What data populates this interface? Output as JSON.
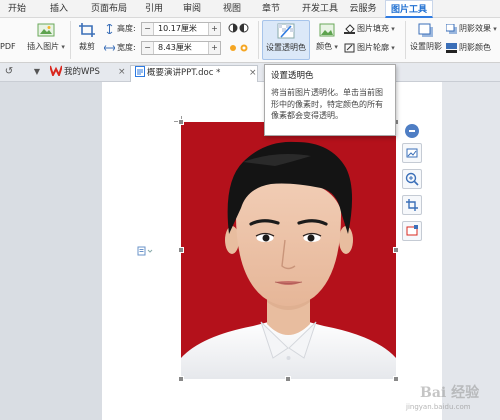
{
  "menu": {
    "tabs": [
      "开始",
      "插入",
      "页面布局",
      "引用",
      "审阅",
      "视图",
      "章节",
      "开发工具",
      "云服务",
      "图片工具"
    ],
    "active_tab": "图片工具"
  },
  "ribbon": {
    "pdf_label": "PDF",
    "insert_picture": "插入图片",
    "crop": "裁剪",
    "height_label": "高度:",
    "height_value": "10.17厘米",
    "width_label": "宽度:",
    "width_value": "8.43厘米",
    "set_transparent": "设置透明色",
    "color": "颜色",
    "picture_fill": "图片填充",
    "picture_outline": "图片轮廓",
    "set_shadow": "设置阴影",
    "shadow_effect": "阴影效果",
    "shadow_color": "阴影颜色",
    "minus": "−",
    "plus": "+"
  },
  "doc_tabs": {
    "tabs": [
      {
        "label": "我的WPS",
        "active": false
      },
      {
        "label": "概要演讲PPT.doc *",
        "active": true
      }
    ],
    "close_glyph": "×"
  },
  "tooltip": {
    "title": "设置透明色",
    "description": "将当前图片透明化。单击当前图形中的像素时，特定颜色的所有像素都会变得透明。"
  },
  "watermark": {
    "text": "Bai 经验",
    "url": "jingyan.baidu.com"
  },
  "colors": {
    "accent": "#2f7be1",
    "photo_background": "#b4111b",
    "wps_logo": "#d9281f"
  },
  "icons": [
    "undo-icon",
    "dropdown-icon",
    "wps-logo-icon",
    "doc-icon",
    "close-icon",
    "collapse-icon",
    "crop-layout-icon",
    "zoom-icon",
    "crop-icon",
    "border-icon",
    "paragraph-icon"
  ]
}
